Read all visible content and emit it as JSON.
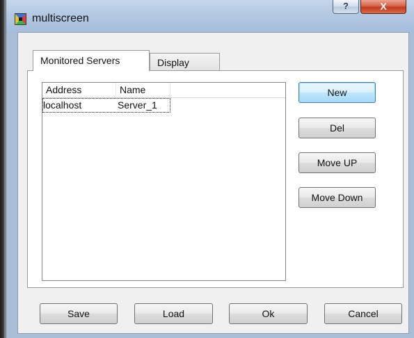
{
  "window": {
    "title": "multiscreen",
    "help_label": "?",
    "close_label": "X"
  },
  "tabs": [
    {
      "label": "Monitored Servers",
      "active": true
    },
    {
      "label": "Display",
      "active": false
    }
  ],
  "server_list": {
    "columns": [
      "Address",
      "Name"
    ],
    "rows": [
      {
        "address": "localhost",
        "name": "Server_1"
      }
    ]
  },
  "side_buttons": {
    "new": "New",
    "del": "Del",
    "move_up": "Move UP",
    "move_down": "Move Down"
  },
  "bottom_buttons": {
    "save": "Save",
    "load": "Load",
    "ok": "Ok",
    "cancel": "Cancel"
  }
}
